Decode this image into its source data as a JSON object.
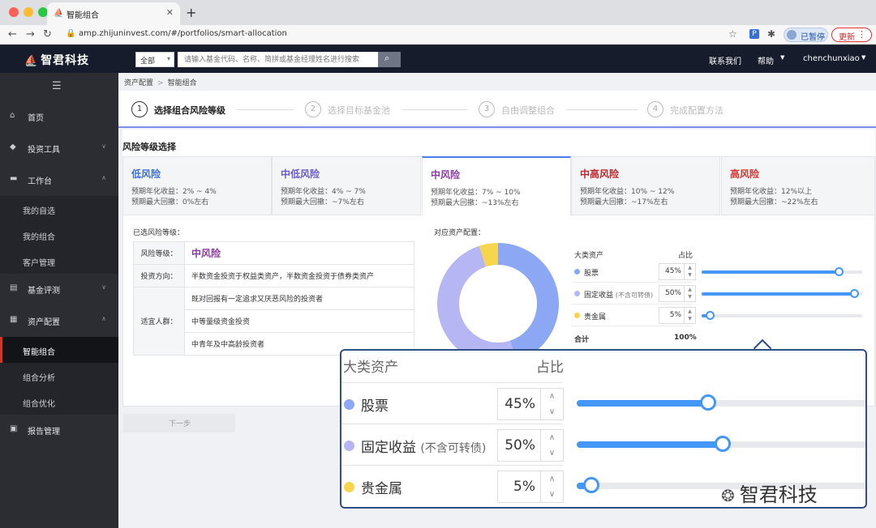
{
  "browser": {
    "tab_title": "智能组合",
    "url": "amp.zhijuninvest.com/#/portfolios/smart-allocation",
    "paused_label": "已暂停",
    "update_label": "更新"
  },
  "header": {
    "logo_text": "智君科技",
    "search_scope": "全部",
    "search_placeholder": "请输入基金代码、名称、简拼或基金经理姓名进行搜索",
    "contact": "联系我们",
    "help": "帮助",
    "user": "chenchunxiao"
  },
  "sidebar": {
    "items": [
      {
        "label": "首页"
      },
      {
        "label": "投资工具"
      },
      {
        "label": "工作台"
      },
      {
        "label": "我的自选"
      },
      {
        "label": "我的组合"
      },
      {
        "label": "客户管理"
      },
      {
        "label": "基金评测"
      },
      {
        "label": "资产配置"
      },
      {
        "label": "智能组合"
      },
      {
        "label": "组合分析"
      },
      {
        "label": "组合优化"
      },
      {
        "label": "报告管理"
      }
    ]
  },
  "breadcrumb": [
    "资产配置",
    "智能组合"
  ],
  "steps": [
    {
      "num": "1",
      "label": "选择组合风险等级"
    },
    {
      "num": "2",
      "label": "选择目标基金池"
    },
    {
      "num": "3",
      "label": "自由调整组合"
    },
    {
      "num": "4",
      "label": "完成配置方法"
    }
  ],
  "risk": {
    "section_title": "风险等级选择",
    "cards": [
      {
        "name": "低风险",
        "color": "#3c6fd6",
        "ret": "预期年化收益：2% ~ 4%",
        "dd": "预期最大回撤：0%左右"
      },
      {
        "name": "中低风险",
        "color": "#6a5acd",
        "ret": "预期年化收益：4% ~ 7%",
        "dd": "预期最大回撤：~7%左右"
      },
      {
        "name": "中风险",
        "color": "#8b3ba3",
        "ret": "预期年化收益：7% ~ 10%",
        "dd": "预期最大回撤：~13%左右"
      },
      {
        "name": "中高风险",
        "color": "#c0262b",
        "ret": "预期年化收益：10% ~ 12%",
        "dd": "预期最大回撤：~17%左右"
      },
      {
        "name": "高风险",
        "color": "#d8342f",
        "ret": "预期年化收益：12%以上",
        "dd": "预期最大回撤：~22%左右"
      }
    ]
  },
  "selected": {
    "title": "已选风险等级：",
    "level_key": "风险等级：",
    "level_value": "中风险",
    "direction_key": "投资方向：",
    "direction_value": "半数资金投资于权益类资产，半数资金投资于债券类资产",
    "people_key": "适宜人群：",
    "people": [
      "既对回报有一定追求又厌恶风险的投资者",
      "中等量级资金投资",
      "中青年及中高龄投资者"
    ]
  },
  "allocation": {
    "title": "对应资产配置：",
    "col_asset": "大类资产",
    "col_pct": "占比",
    "total_label": "合计",
    "total_value": "100%",
    "assets": [
      {
        "name": "股票",
        "sub": "",
        "pct": 45,
        "pct_text": "45%",
        "color": "#8ca8f4"
      },
      {
        "name": "固定收益",
        "sub": "(不含可转债)",
        "pct": 50,
        "pct_text": "50%",
        "color": "#b7b6f5"
      },
      {
        "name": "贵金属",
        "sub": "",
        "pct": 5,
        "pct_text": "5%",
        "color": "#f7d54d"
      }
    ]
  },
  "next_button": "下一步",
  "watermark": "智君科技"
}
